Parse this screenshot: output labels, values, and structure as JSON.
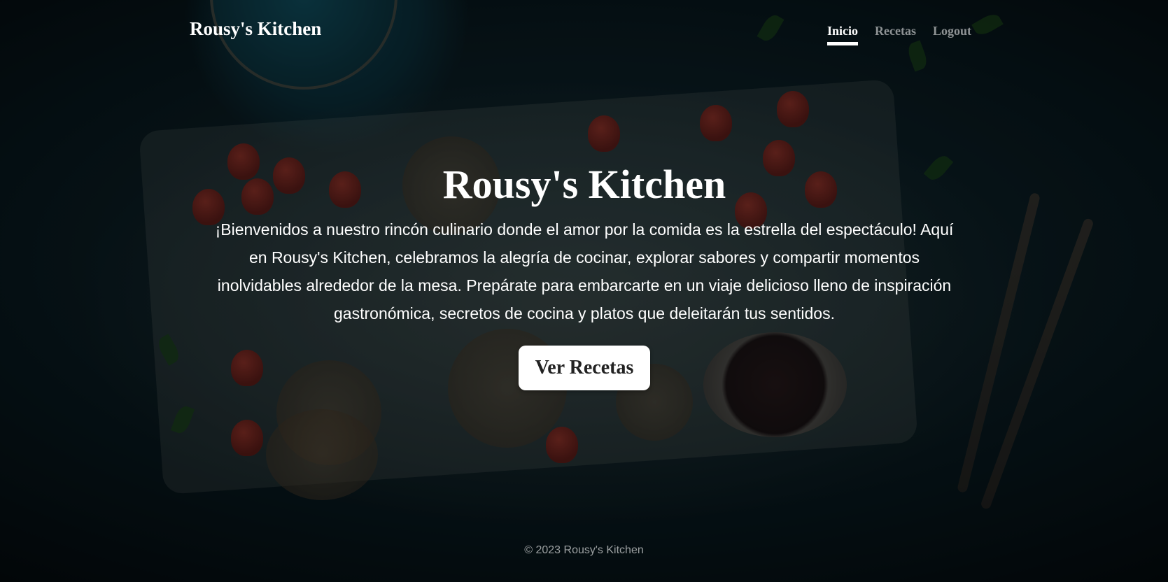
{
  "header": {
    "brand": "Rousy's Kitchen",
    "nav": [
      {
        "label": "Inicio",
        "active": true
      },
      {
        "label": "Recetas",
        "active": false
      },
      {
        "label": "Logout",
        "active": false
      }
    ]
  },
  "hero": {
    "title": "Rousy's Kitchen",
    "description": "¡Bienvenidos a nuestro rincón culinario donde el amor por la comida es la estrella del espectáculo! Aquí en Rousy's Kitchen, celebramos la alegría de cocinar, explorar sabores y compartir momentos inolvidables alrededor de la mesa. Prepárate para embarcarte en un viaje delicioso lleno de inspiración gastronómica, secretos de cocina y platos que deleitarán tus sentidos.",
    "cta_label": "Ver Recetas"
  },
  "footer": {
    "copyright": "© 2023 Rousy's Kitchen"
  },
  "colors": {
    "text": "#ffffff",
    "nav_inactive": "rgba(255,255,255,0.55)",
    "button_bg": "#ffffff",
    "button_text": "#222222"
  }
}
